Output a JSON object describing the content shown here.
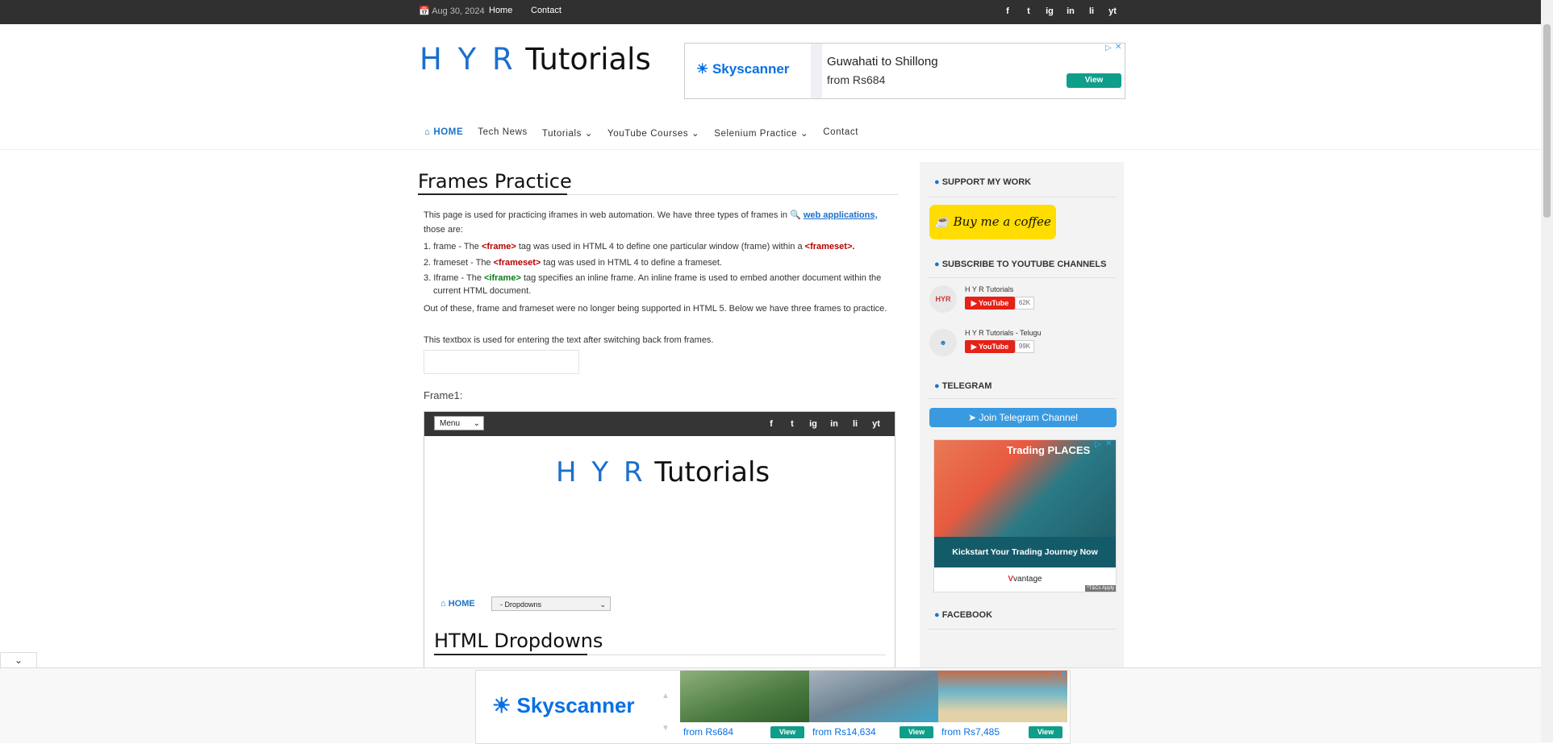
{
  "topbar": {
    "date": "Aug 30, 2024",
    "links": [
      "Home",
      "Contact"
    ],
    "social": [
      "f",
      "t",
      "ig",
      "in",
      "li",
      "yt"
    ]
  },
  "logo": {
    "part1": "H Y R",
    "part2": "Tutorials"
  },
  "ad_top": {
    "brand": "Skyscanner",
    "route": "Guwahati to Shillong",
    "price": "from Rs684",
    "button": "View"
  },
  "nav": [
    {
      "label": "HOME",
      "active": true
    },
    {
      "label": "Tech News"
    },
    {
      "label": "Tutorials ⌄"
    },
    {
      "label": "YouTube Courses ⌄"
    },
    {
      "label": "Selenium Practice ⌄"
    },
    {
      "label": "Contact"
    }
  ],
  "content": {
    "title": "Frames Practice",
    "intro_1": "This page is used for practicing iframes in web automation. We have three types of frames in",
    "intro_link": "web applications,",
    "intro_2": "those are:",
    "item1_a": "1. frame - The",
    "item1_tag": "<frame>",
    "item1_b": "tag was used in HTML 4 to define one particular window (frame) within a",
    "item1_tag2": "<frameset>.",
    "item2_a": "2. frameset - The",
    "item2_tag": "<frameset>",
    "item2_b": "tag was used in HTML 4 to define a frameset.",
    "item3_a": "3. Iframe - The",
    "item3_tag": "<iframe>",
    "item3_b": "tag specifies an inline frame. An inline frame is used to embed another document within the",
    "item3_c": "current HTML document.",
    "outro": "Out of these, frame and frameset were no longer being supported in HTML 5. Below we have three frames to practice.",
    "textbox_label": "This textbox is used for entering the text after switching back from frames.",
    "frame1_label": "Frame1:"
  },
  "frame1": {
    "menu": "Menu",
    "logo1": "H Y R",
    "logo2": "Tutorials",
    "home": "HOME",
    "dropdown": "- Dropdowns",
    "title": "HTML Dropdowns"
  },
  "sidebar": {
    "support_heading": "SUPPORT MY WORK",
    "coffee": "Buy me a coffee",
    "subscribe_heading": "SUBSCRIBE TO YOUTUBE CHANNELS",
    "channels": [
      {
        "name": "H Y R Tutorials",
        "button": "YouTube",
        "count": "62K"
      },
      {
        "name": "H Y R Tutorials - Telugu",
        "button": "YouTube",
        "count": "99K"
      }
    ],
    "telegram_heading": "TELEGRAM",
    "telegram_button": "Join Telegram Channel",
    "ad": {
      "headline": "Trading PLACES",
      "caption": "Kickstart Your Trading Journey Now",
      "brand": "vantage",
      "tc": "*T&Cs Apply"
    },
    "facebook_heading": "FACEBOOK"
  },
  "bottom_ad": {
    "brand": "Skyscanner",
    "tiles": [
      {
        "price": "from Rs684",
        "button": "View",
        "color": "#5f8a4e"
      },
      {
        "price": "from Rs14,634",
        "button": "View",
        "color": "#7e8f9c"
      },
      {
        "price": "from Rs7,485",
        "button": "View",
        "color": "#4f9bb7"
      }
    ]
  }
}
